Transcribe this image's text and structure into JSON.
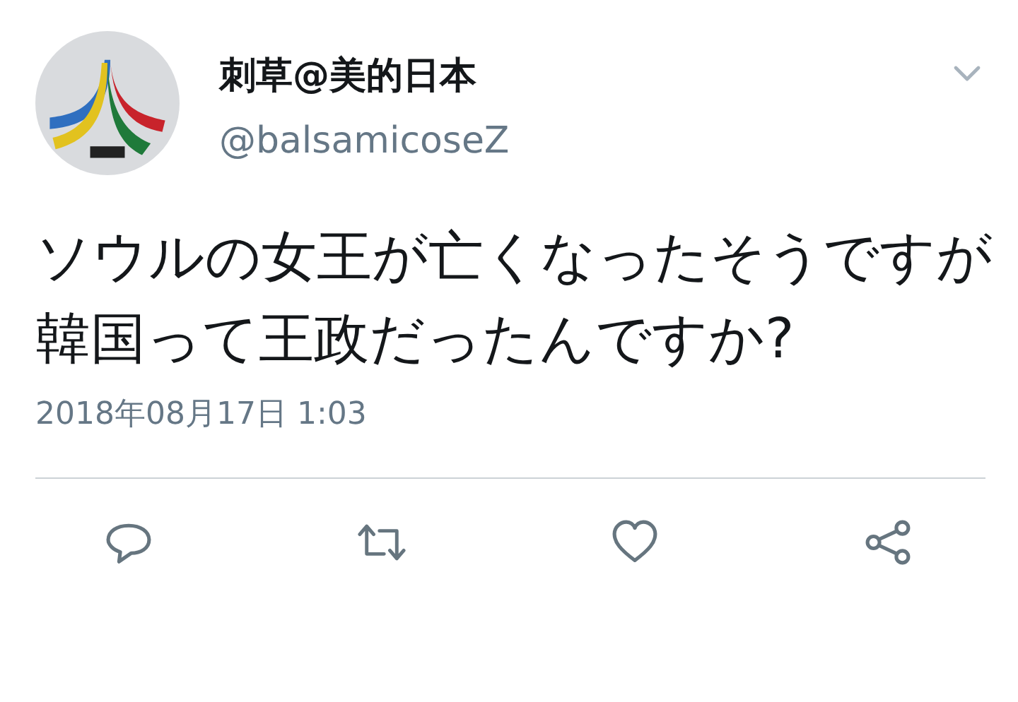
{
  "tweet": {
    "display_name": "刺草@美的日本",
    "handle": "@balsamicoseZ",
    "paragraphs": [
      "ソウルの女王が亡くなったそうですが",
      "韓国って王政だったんですか?"
    ],
    "timestamp": "2018年08月17日 1:03",
    "actions": [
      {
        "kind": "reply"
      },
      {
        "kind": "retweet"
      },
      {
        "kind": "like"
      },
      {
        "kind": "share"
      }
    ]
  }
}
